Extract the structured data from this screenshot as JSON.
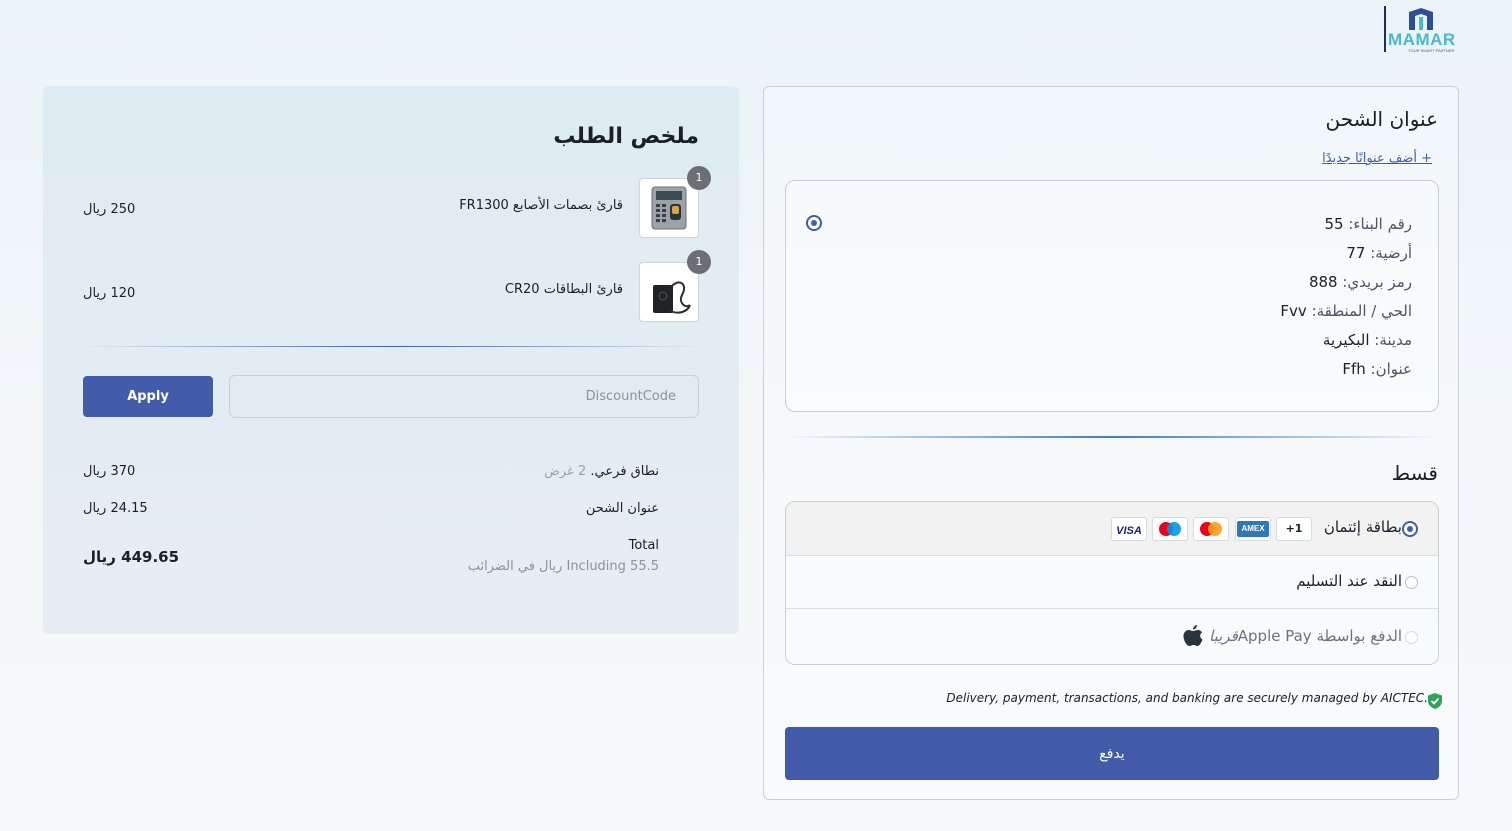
{
  "brand": {
    "name": "MAMAR",
    "tagline": "YOUR SMART PARTNER",
    "primary_color": "#425caa",
    "accent_color": "#4ab7d4"
  },
  "summary": {
    "title": "ملخص الطلب",
    "items": [
      {
        "name": "قارئ بصمات الأصابع FR1300",
        "price": "250 ريال",
        "qty": "1",
        "image": "fingerprint-reader-icon"
      },
      {
        "name": "قارئ البطاقات CR20",
        "price": "120 ريال",
        "qty": "1",
        "image": "card-reader-icon"
      }
    ],
    "discount": {
      "placeholder": "DiscountCode",
      "value": "",
      "apply_label": "Apply"
    },
    "subtotal": {
      "label": "نطاق فرعي.",
      "count": "2 غرض",
      "value": "370 ريال"
    },
    "shipping": {
      "label": "عنوان الشحن",
      "value": "24.15 ريال"
    },
    "total": {
      "label": "Total",
      "tax_note": "Including 55.5 ريال في الضرائب",
      "value": "449.65 ريال"
    }
  },
  "shipping_section": {
    "title": "عنوان الشحن",
    "add_link": "+ أضف عنوانًا جديدًا",
    "address": [
      {
        "key": "رقم البناء:",
        "value": "55"
      },
      {
        "key": "أرضية:",
        "value": "77"
      },
      {
        "key": "رمز بريدي:",
        "value": "888"
      },
      {
        "key": "الحي / المنطقة:",
        "value": "Fvv"
      },
      {
        "key": "مدينة:",
        "value": "البكيرية"
      },
      {
        "key": "عنوان:",
        "value": "Ffh"
      }
    ]
  },
  "payment_section": {
    "title": "قسط",
    "options": [
      {
        "label": "بطاقة إئتمان",
        "selected": true
      },
      {
        "label": "النقد عند التسليم",
        "selected": false
      },
      {
        "label": "الدفع بواسطة Apple Pay",
        "soon": "قريبا",
        "selected": false,
        "disabled": true
      }
    ],
    "card_brands": {
      "more": "+1",
      "amex": "AMEX",
      "visa": "VISA"
    },
    "secure_note": "Delivery, payment, transactions, and banking are securely managed by AICTEC.",
    "pay_label": "يدفع"
  }
}
